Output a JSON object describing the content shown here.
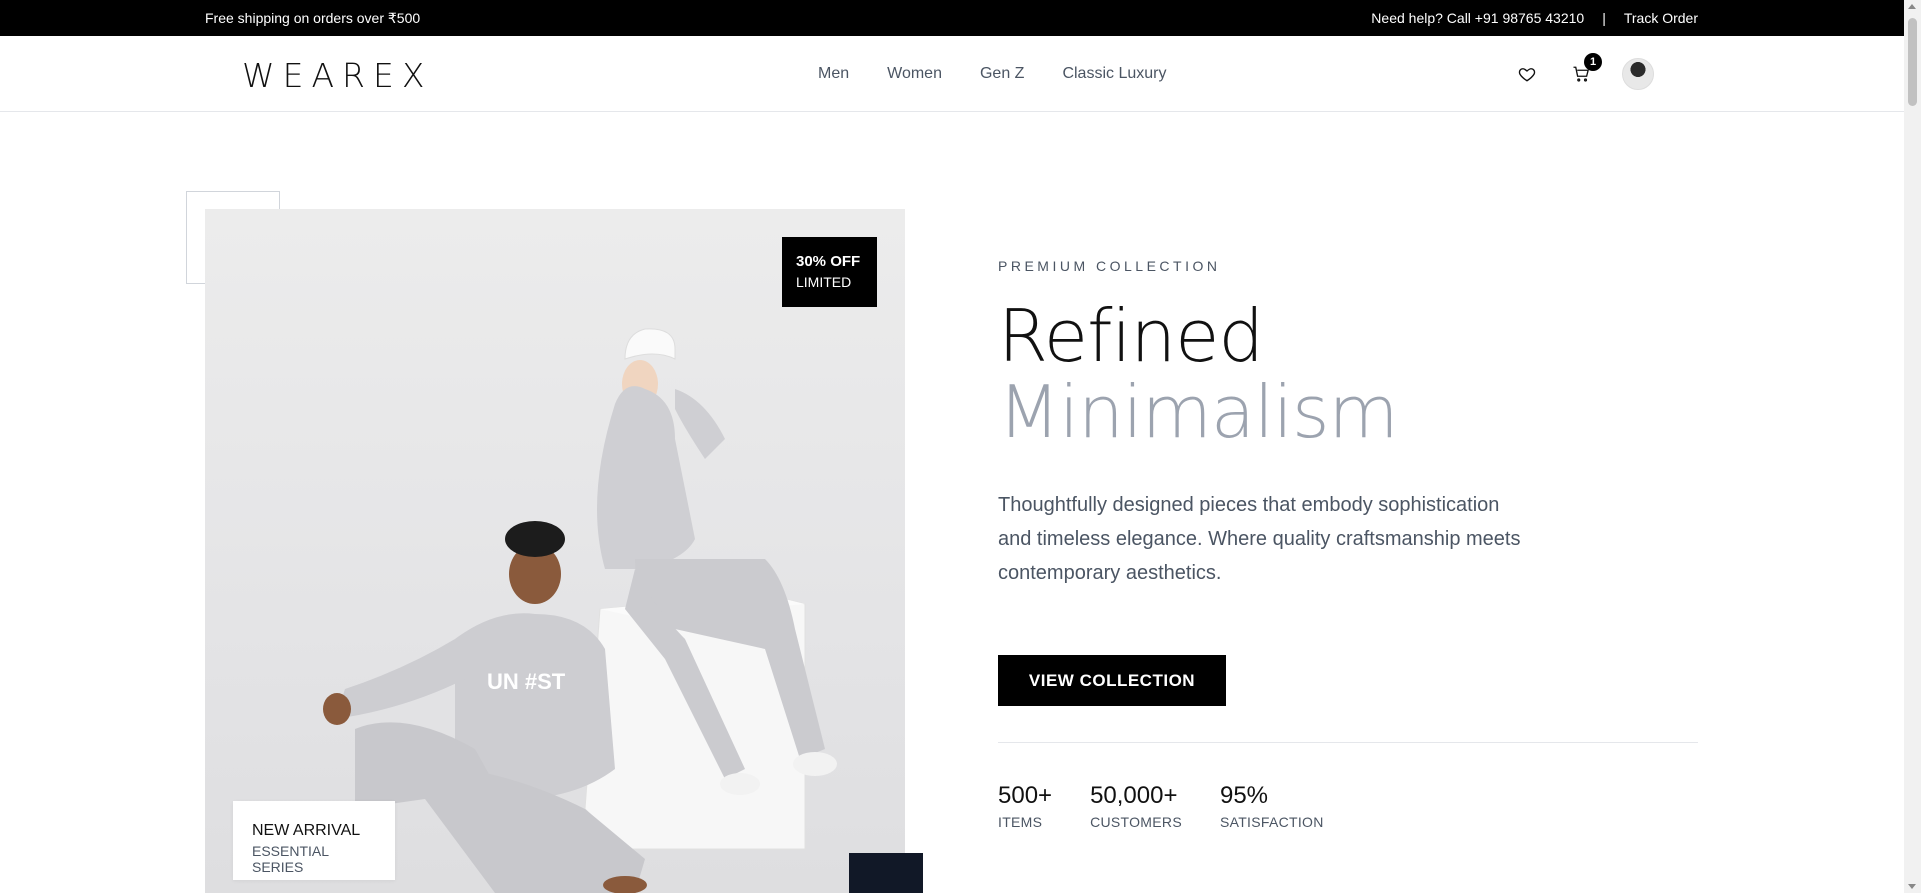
{
  "topbar": {
    "shipping": "Free shipping on orders over ₹500",
    "help": "Need help? Call +91 98765 43210",
    "separator": "|",
    "track": "Track Order"
  },
  "header": {
    "logo": "WEAREX",
    "nav": [
      "Men",
      "Women",
      "Gen Z",
      "Classic Luxury"
    ],
    "icons": [
      "heart-icon",
      "cart-icon",
      "avatar"
    ],
    "cart_count": "1"
  },
  "hero": {
    "promo_line1": "30% OFF",
    "promo_line2": "LIMITED",
    "badge_line1": "NEW ARRIVAL",
    "badge_line2": "ESSENTIAL SERIES",
    "eyebrow": "PREMIUM COLLECTION",
    "title_line1": "Refined",
    "title_line2": "Minimalism",
    "description": "Thoughtfully designed pieces that embody sophistication and timeless elegance. Where quality craftsmanship meets contemporary aesthetics.",
    "cta": "VIEW COLLECTION",
    "image_print_text": "UN #ST",
    "stats": [
      {
        "value": "500+",
        "label": "ITEMS"
      },
      {
        "value": "50,000+",
        "label": "CUSTOMERS"
      },
      {
        "value": "95%",
        "label": "SATISFACTION"
      }
    ]
  },
  "colors": {
    "topbar_bg": "#000000",
    "accent": "#000000",
    "muted_text": "#4b5563",
    "title_light": "#9ca3af",
    "dark_square": "#111827"
  }
}
